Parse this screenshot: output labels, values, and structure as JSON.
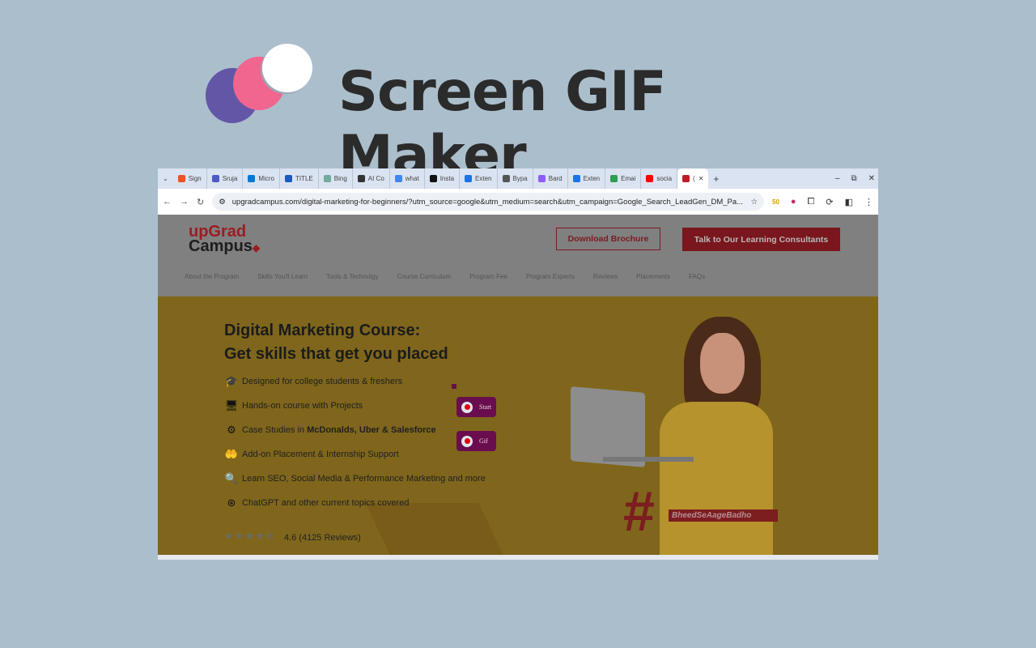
{
  "brand": {
    "title": "Screen GIF Maker",
    "logo_colors": [
      "#6356a6",
      "#f0668e",
      "#ffffff"
    ]
  },
  "browser": {
    "tabs": [
      {
        "label": "Sign",
        "icon": "microsoft-icon"
      },
      {
        "label": "Sruja",
        "icon": "teams-icon"
      },
      {
        "label": "Micro",
        "icon": "onedrive-icon"
      },
      {
        "label": "TITLE",
        "icon": "word-icon"
      },
      {
        "label": "Bing",
        "icon": "chatgpt-icon"
      },
      {
        "label": "AI Co",
        "icon": "copyright-icon"
      },
      {
        "label": "what",
        "icon": "google-icon"
      },
      {
        "label": "Insta",
        "icon": "wikipedia-icon"
      },
      {
        "label": "Exten",
        "icon": "puzzle-icon"
      },
      {
        "label": "Bypa",
        "icon": "openai-icon"
      },
      {
        "label": "Bard",
        "icon": "bard-icon"
      },
      {
        "label": "Exten",
        "icon": "puzzle-icon"
      },
      {
        "label": "Emai",
        "icon": "email-icon"
      },
      {
        "label": "socia",
        "icon": "youtube-icon"
      },
      {
        "label": "(",
        "icon": "upgrad-icon",
        "active": true
      }
    ],
    "url": "upgradcampus.com/digital-marketing-for-beginners/?utm_source=google&utm_medium=search&utm_campaign=Google_Search_LeadGen_DM_Pa...",
    "ext_badge": "50"
  },
  "site": {
    "logo_line1": "upGrad",
    "logo_line2": "Campus",
    "download_btn": "Download Brochure",
    "consult_btn": "Talk to Our Learning Consultants",
    "nav": [
      "About the Program",
      "Skills You'll Learn",
      "Tools & Technolgy",
      "Course Curriculum",
      "Program Fee",
      "Program Experts",
      "Reviews",
      "Placements",
      "FAQs"
    ],
    "headline1": "Digital Marketing Course:",
    "headline2": "Get skills that get you placed",
    "features": [
      {
        "text": "Designed for college students & freshers",
        "icon": "graduate-icon"
      },
      {
        "text": "Hands-on course with Projects",
        "icon": "monitor-icon"
      },
      {
        "text_pre": "Case Studies in ",
        "text_bold": "McDonalds, Uber & Salesforce",
        "icon": "gear-tools-icon"
      },
      {
        "text": "Add-on Placement & Internship Support",
        "icon": "hand-person-icon"
      },
      {
        "text": "Learn SEO, Social Media & Performance Marketing and more",
        "icon": "search-megaphone-icon"
      },
      {
        "text": "ChatGPT and other current topics covered",
        "icon": "chatgpt-icon"
      }
    ],
    "rating_value": "4.6",
    "rating_text": "4.6 (4125 Reviews)",
    "stars": "★★★★⯪",
    "hashtag": "BheedSeAageBadho"
  },
  "recorder": {
    "start_label": "Start",
    "gif_label": "Gif"
  }
}
